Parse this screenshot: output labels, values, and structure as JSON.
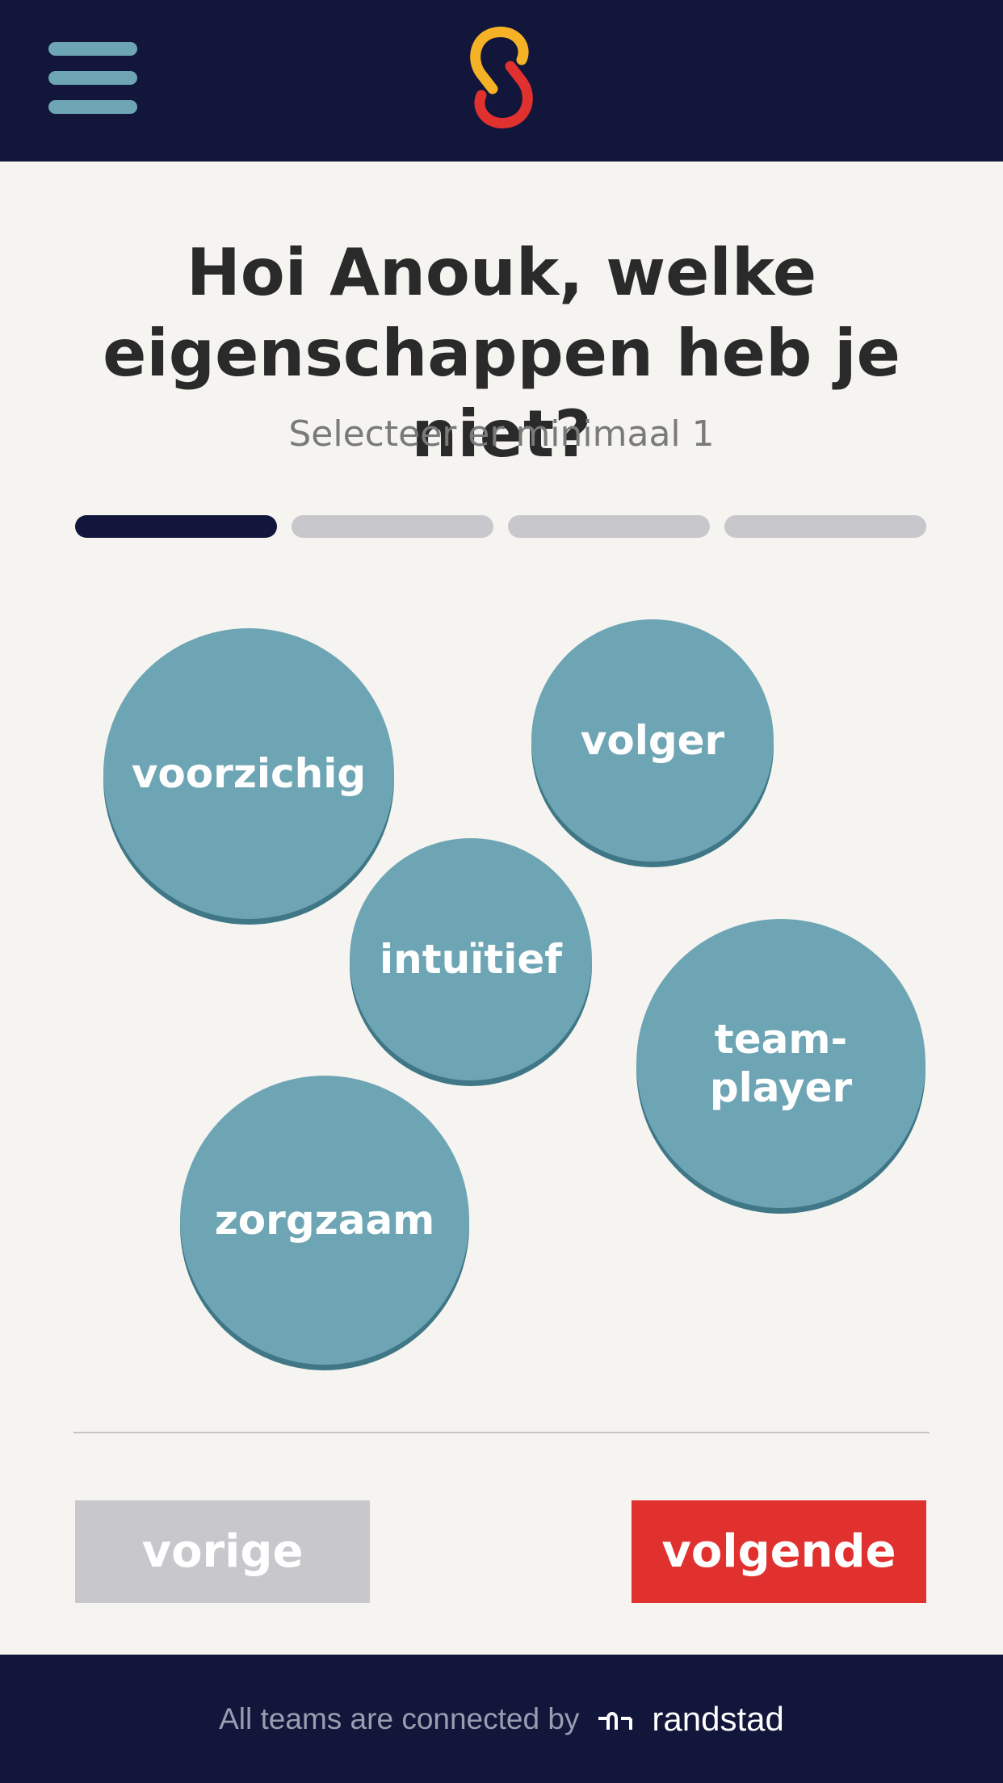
{
  "header": {
    "menu_icon": "hamburger-menu-icon",
    "logo_icon": "linked-s-logo-icon",
    "logo_colors": {
      "top": "#f5b227",
      "bottom": "#e0312f"
    }
  },
  "question": {
    "title": "Hoi Anouk, welke eigenschappen heb je niet?",
    "subtitle": "Selecteer er minimaal 1"
  },
  "progress": {
    "current_step": 1,
    "total_steps": 4
  },
  "traits": [
    {
      "label": "voorzichig"
    },
    {
      "label": "volger"
    },
    {
      "label": "intuïtief"
    },
    {
      "label": "team-player"
    },
    {
      "label": "zorgzaam"
    }
  ],
  "buttons": {
    "previous_label": "vorige",
    "next_label": "volgende"
  },
  "footer": {
    "text": "All teams are connected by",
    "brand_icon": "randstad-logo-icon",
    "brand": "randstad"
  },
  "colors": {
    "navy": "#11163a",
    "bubble": "#6ea5b4",
    "accent_red": "#e0312f",
    "inactive_gray": "#c8c8cc"
  }
}
